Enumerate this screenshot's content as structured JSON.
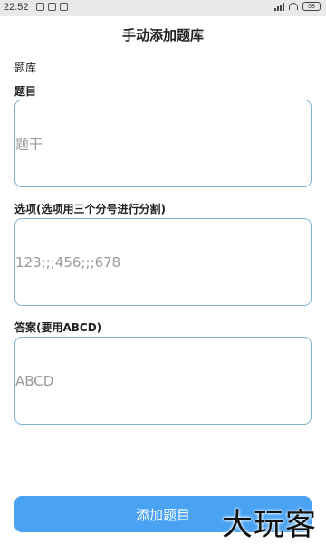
{
  "status_bar": {
    "time": "22:52",
    "battery": "58"
  },
  "header": {
    "title": "手动添加题库"
  },
  "form": {
    "bank_label": "题库",
    "question_label": "题目",
    "question_value": "题干",
    "options_label": "选项(选项用三个分号进行分割)",
    "options_value": "123;;;456;;;678",
    "answer_label": "答案(要用ABCD)",
    "answer_value": "ABCD"
  },
  "actions": {
    "submit_label": "添加题目"
  },
  "watermark": {
    "text": "大玩客"
  },
  "colors": {
    "accent": "#4aa3f2",
    "field_border": "#7fb2d3",
    "status_bar": "#e9e9e9"
  },
  "icons": [
    "signal-icon",
    "wifi-icon",
    "battery-icon",
    "notification-icon",
    "image-icon",
    "settings-icon"
  ]
}
